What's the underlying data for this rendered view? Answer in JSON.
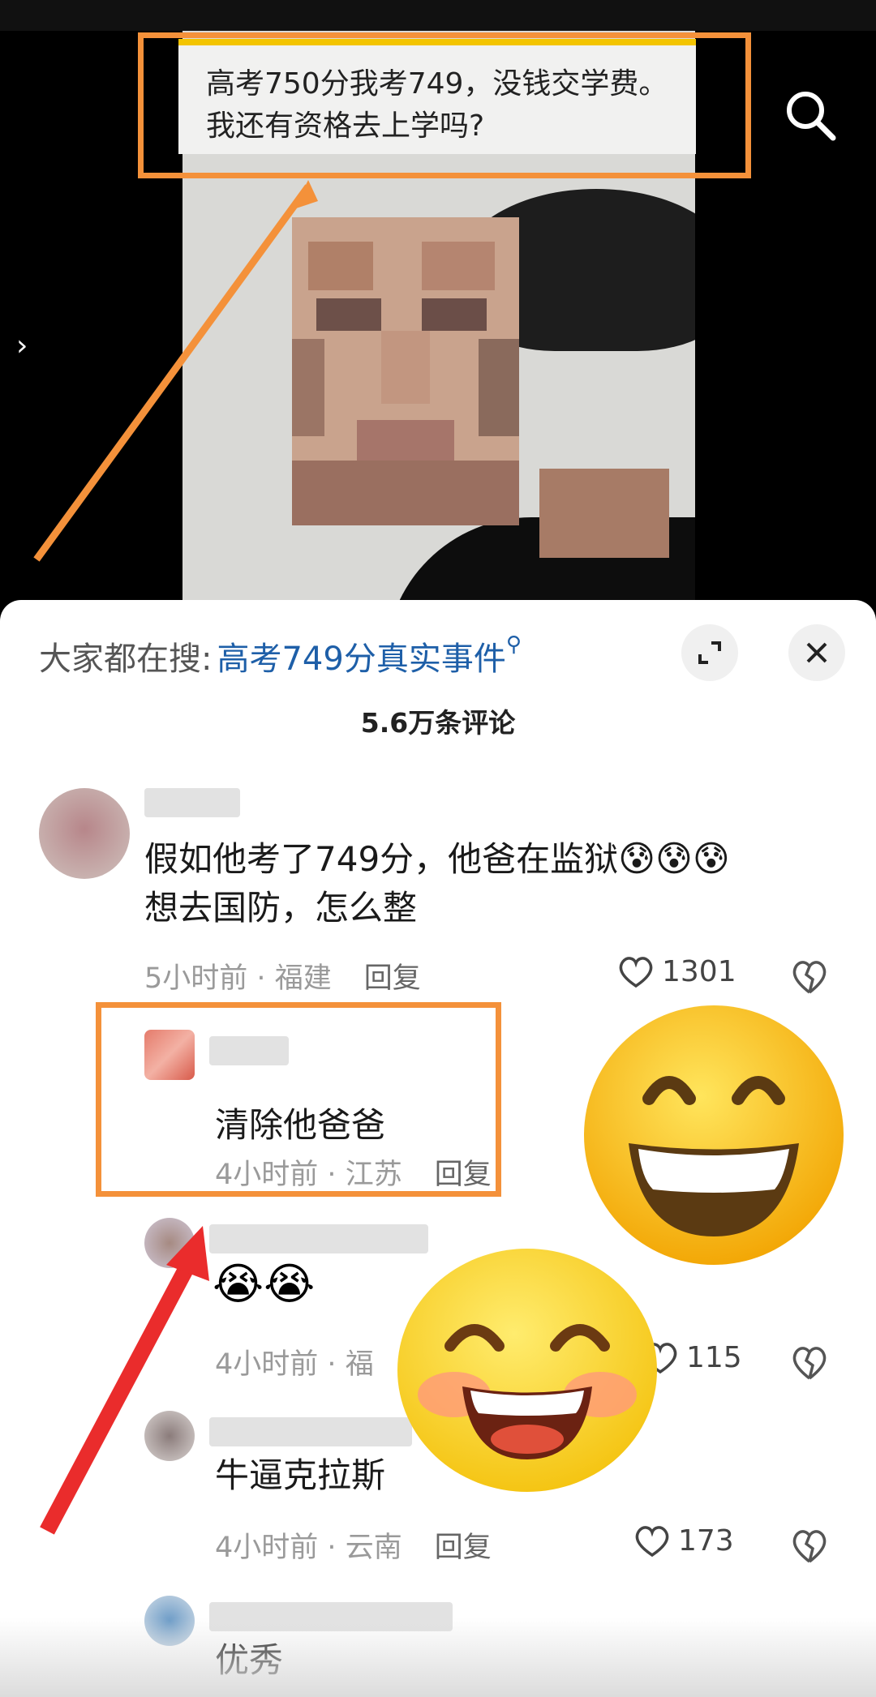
{
  "video": {
    "caption_line1": "高考750分我考749，没钱交学费。",
    "caption_line2": "我还有资格去上学吗?"
  },
  "panel": {
    "trending_prefix": "大家都在搜:",
    "trending_query": "高考749分真实事件",
    "comment_count": "5.6万条评论"
  },
  "comments": [
    {
      "text_line1": "假如他考了749分，他爸在监狱",
      "text_line2": "想去国防，怎么整",
      "time": "5小时前",
      "location": "福建",
      "reply": "回复",
      "likes": "1301"
    },
    {
      "text": "清除他爸爸",
      "time": "4小时前",
      "location": "江苏",
      "reply": "回复"
    },
    {
      "time": "4小时前",
      "location": "福",
      "likes": "115"
    },
    {
      "text": "牛逼克拉斯",
      "time": "4小时前",
      "location": "云南",
      "reply": "回复",
      "likes": "173"
    },
    {
      "text": "优秀"
    }
  ],
  "meta_separator": "·",
  "colors": {
    "accent_link": "#1e5fa8",
    "annotation_orange": "#f4913a",
    "annotation_red": "#ea2c2c",
    "caption_bar_yellow": "#f3c400"
  },
  "icons": [
    "search-icon",
    "chevron-right-icon",
    "expand-icon",
    "close-icon",
    "heart-icon",
    "broken-heart-icon",
    "grimacing-tear-emoji-icon",
    "laughing-crying-emoji-icon",
    "grinning-face-emoji",
    "smiling-face-emoji"
  ]
}
